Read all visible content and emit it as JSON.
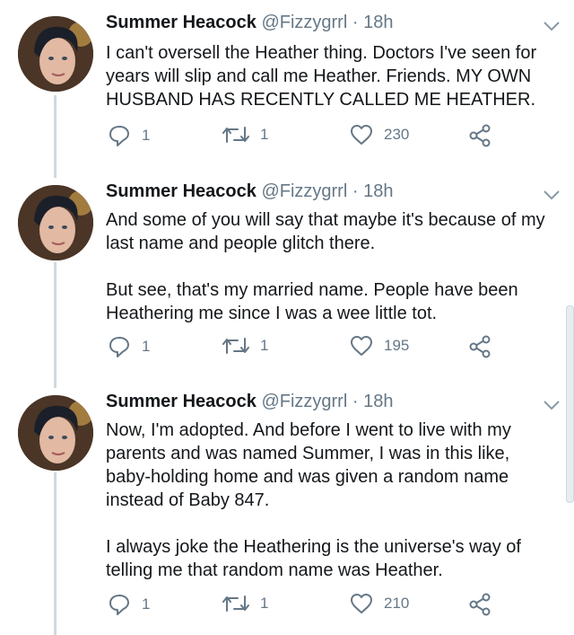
{
  "tweets": [
    {
      "name": "Summer Heacock",
      "handle": "@Fizzygrrl",
      "separator": "·",
      "time": "18h",
      "paragraphs": [
        "I can't oversell the Heather thing. Doctors I've seen for years will slip and call me Heather. Friends. MY OWN HUSBAND HAS RECENTLY CALLED ME HEATHER."
      ],
      "replies": "1",
      "retweets": "1",
      "likes": "230"
    },
    {
      "name": "Summer Heacock",
      "handle": "@Fizzygrrl",
      "separator": "·",
      "time": "18h",
      "paragraphs": [
        "And some of you will say that maybe it's because of my last name and people glitch there.",
        "But see, that's my married name. People have been Heathering me since I was a wee little tot."
      ],
      "replies": "1",
      "retweets": "1",
      "likes": "195"
    },
    {
      "name": "Summer Heacock",
      "handle": "@Fizzygrrl",
      "separator": "·",
      "time": "18h",
      "paragraphs": [
        "Now, I'm adopted. And before I went to live with my parents and was named Summer, I was in this like, baby-holding home and was given a random name instead of Baby 847.",
        "I always joke the Heathering is the universe's way of telling me that random name was Heather."
      ],
      "replies": "1",
      "retweets": "1",
      "likes": "210"
    }
  ],
  "icons": {
    "reply": "reply-icon",
    "retweet": "retweet-icon",
    "like": "heart-icon",
    "share": "share-icon",
    "menu": "chevron-down-icon"
  },
  "colors": {
    "text": "#14171a",
    "secondary": "#657786",
    "thread_line": "#cfd9de"
  }
}
